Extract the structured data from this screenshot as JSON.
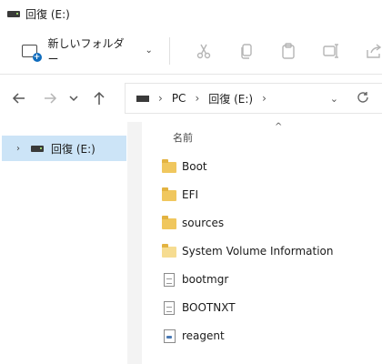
{
  "window": {
    "title": "回復 (E:)"
  },
  "toolbar": {
    "new_folder_label": "新しいフォルダー",
    "icons": [
      "cut-icon",
      "copy-icon",
      "paste-icon",
      "rename-icon",
      "share-icon"
    ]
  },
  "address": {
    "crumbs": [
      "PC",
      "回復 (E:)"
    ]
  },
  "sidebar": {
    "items": [
      {
        "label": "回復 (E:)"
      }
    ]
  },
  "content": {
    "column_header": "名前",
    "files": [
      {
        "name": "Boot",
        "type": "folder"
      },
      {
        "name": "EFI",
        "type": "folder"
      },
      {
        "name": "sources",
        "type": "folder"
      },
      {
        "name": "System Volume Information",
        "type": "folder-light"
      },
      {
        "name": "bootmgr",
        "type": "file"
      },
      {
        "name": "BOOTNXT",
        "type": "file"
      },
      {
        "name": "reagent",
        "type": "config"
      }
    ]
  },
  "colors": {
    "selection": "#cce4f7",
    "folder": "#f0c75e",
    "accent": "#0f6cbd"
  }
}
